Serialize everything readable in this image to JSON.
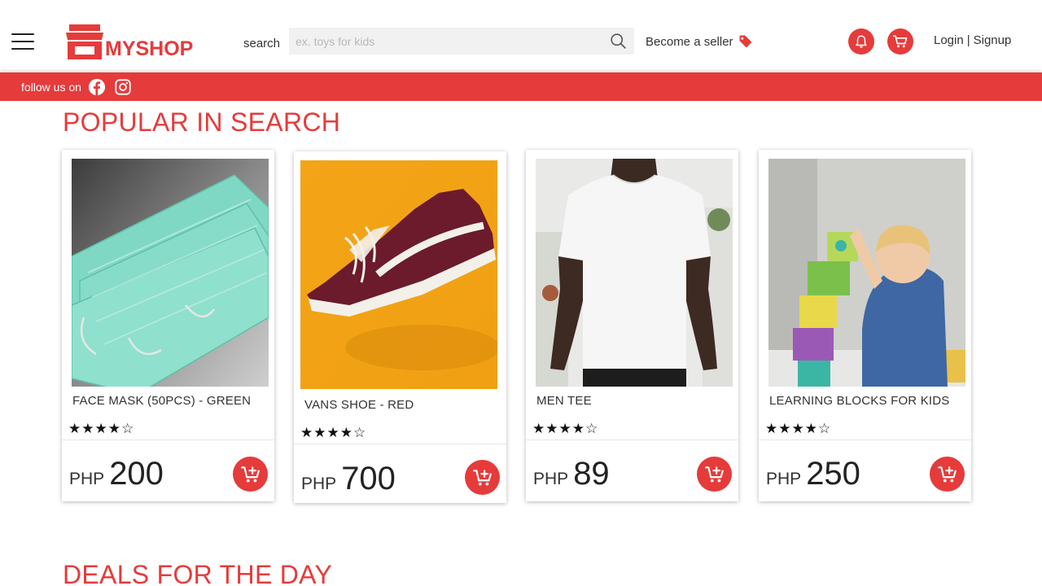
{
  "brand": {
    "name": "MYSHOP",
    "color": "#e53b3b"
  },
  "header": {
    "search_label": "search",
    "search_placeholder": "ex. toys for kids",
    "search_value": "",
    "become_seller": "Become a seller",
    "login": "Login",
    "separator": "|",
    "signup": "Signup",
    "icons": [
      "menu-icon",
      "search-icon",
      "tag-icon",
      "bell-icon",
      "cart-icon"
    ]
  },
  "follow_bar": {
    "text": "follow us on",
    "icons": [
      "facebook-icon",
      "instagram-icon"
    ]
  },
  "sections": {
    "popular": "POPULAR IN SEARCH",
    "deals": "DEALS FOR THE DAY"
  },
  "products": [
    {
      "name": "FACE MASK (50PCS) - GREEN",
      "rating": 4,
      "stars": "★★★★☆",
      "currency": "PHP",
      "price": "200"
    },
    {
      "name": "VANS SHOE - RED",
      "rating": 4,
      "stars": "★★★★☆",
      "currency": "PHP",
      "price": "700"
    },
    {
      "name": "MEN TEE",
      "rating": 4,
      "stars": "★★★★☆",
      "currency": "PHP",
      "price": "89"
    },
    {
      "name": "LEARNING BLOCKS FOR KIDS",
      "rating": 4,
      "stars": "★★★★☆",
      "currency": "PHP",
      "price": "250"
    }
  ]
}
